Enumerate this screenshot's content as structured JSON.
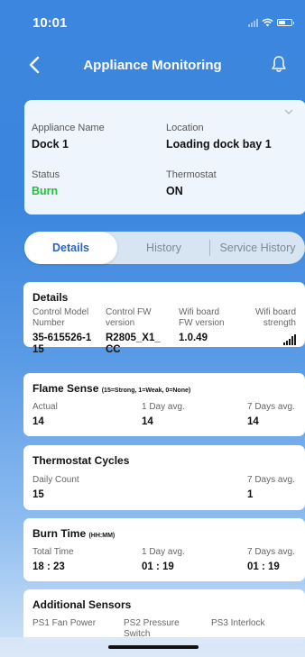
{
  "status_bar": {
    "time": "10:01"
  },
  "header": {
    "title": "Appliance Monitoring"
  },
  "summary": {
    "name_label": "Appliance Name",
    "name_value": "Dock 1",
    "location_label": "Location",
    "location_value": "Loading dock bay 1",
    "status_label": "Status",
    "status_value": "Burn",
    "status_color": "#22c03a",
    "thermostat_label": "Thermostat",
    "thermostat_value": "ON"
  },
  "tabs": [
    {
      "label": "Details",
      "active": true
    },
    {
      "label": "History",
      "active": false
    },
    {
      "label": "Service History",
      "active": false
    }
  ],
  "details": {
    "title": "Details",
    "columns": [
      {
        "label": "Control Model Number",
        "value": "35-615526-1 15"
      },
      {
        "label": "Control FW version",
        "value": "R2805_X1_ CC"
      },
      {
        "label": "Wifi board FW version",
        "value": "1.0.49"
      },
      {
        "label": "Wifi board strength",
        "icon": "wifi-strength-bars"
      }
    ]
  },
  "flame_sense": {
    "title": "Flame Sense",
    "unit": "(15=Strong, 1=Weak, 0=None)",
    "columns": [
      {
        "label": "Actual",
        "value": "14"
      },
      {
        "label": "1 Day avg.",
        "value": "14"
      },
      {
        "label": "7 Days avg.",
        "value": "14"
      }
    ]
  },
  "thermostat_cycles": {
    "title": "Thermostat Cycles",
    "columns": [
      {
        "label": "Daily Count",
        "value": "15"
      },
      {
        "label": "7 Days avg.",
        "value": "1"
      }
    ]
  },
  "burn_time": {
    "title": "Burn Time",
    "unit": "(HH:MM)",
    "columns": [
      {
        "label": "Total Time",
        "value": "18 : 23"
      },
      {
        "label": "1 Day avg.",
        "value": "01 : 19"
      },
      {
        "label": "7 Days avg.",
        "value": "01 : 19"
      }
    ]
  },
  "additional_sensors": {
    "title": "Additional Sensors",
    "columns": [
      {
        "label": "PS1 Fan Power"
      },
      {
        "label": "PS2 Pressure Switch"
      },
      {
        "label": "PS3 Interlock"
      }
    ]
  },
  "colors": {
    "accent": "#2a64c4",
    "background": "#3d86df",
    "status_ok": "#22c03a"
  }
}
